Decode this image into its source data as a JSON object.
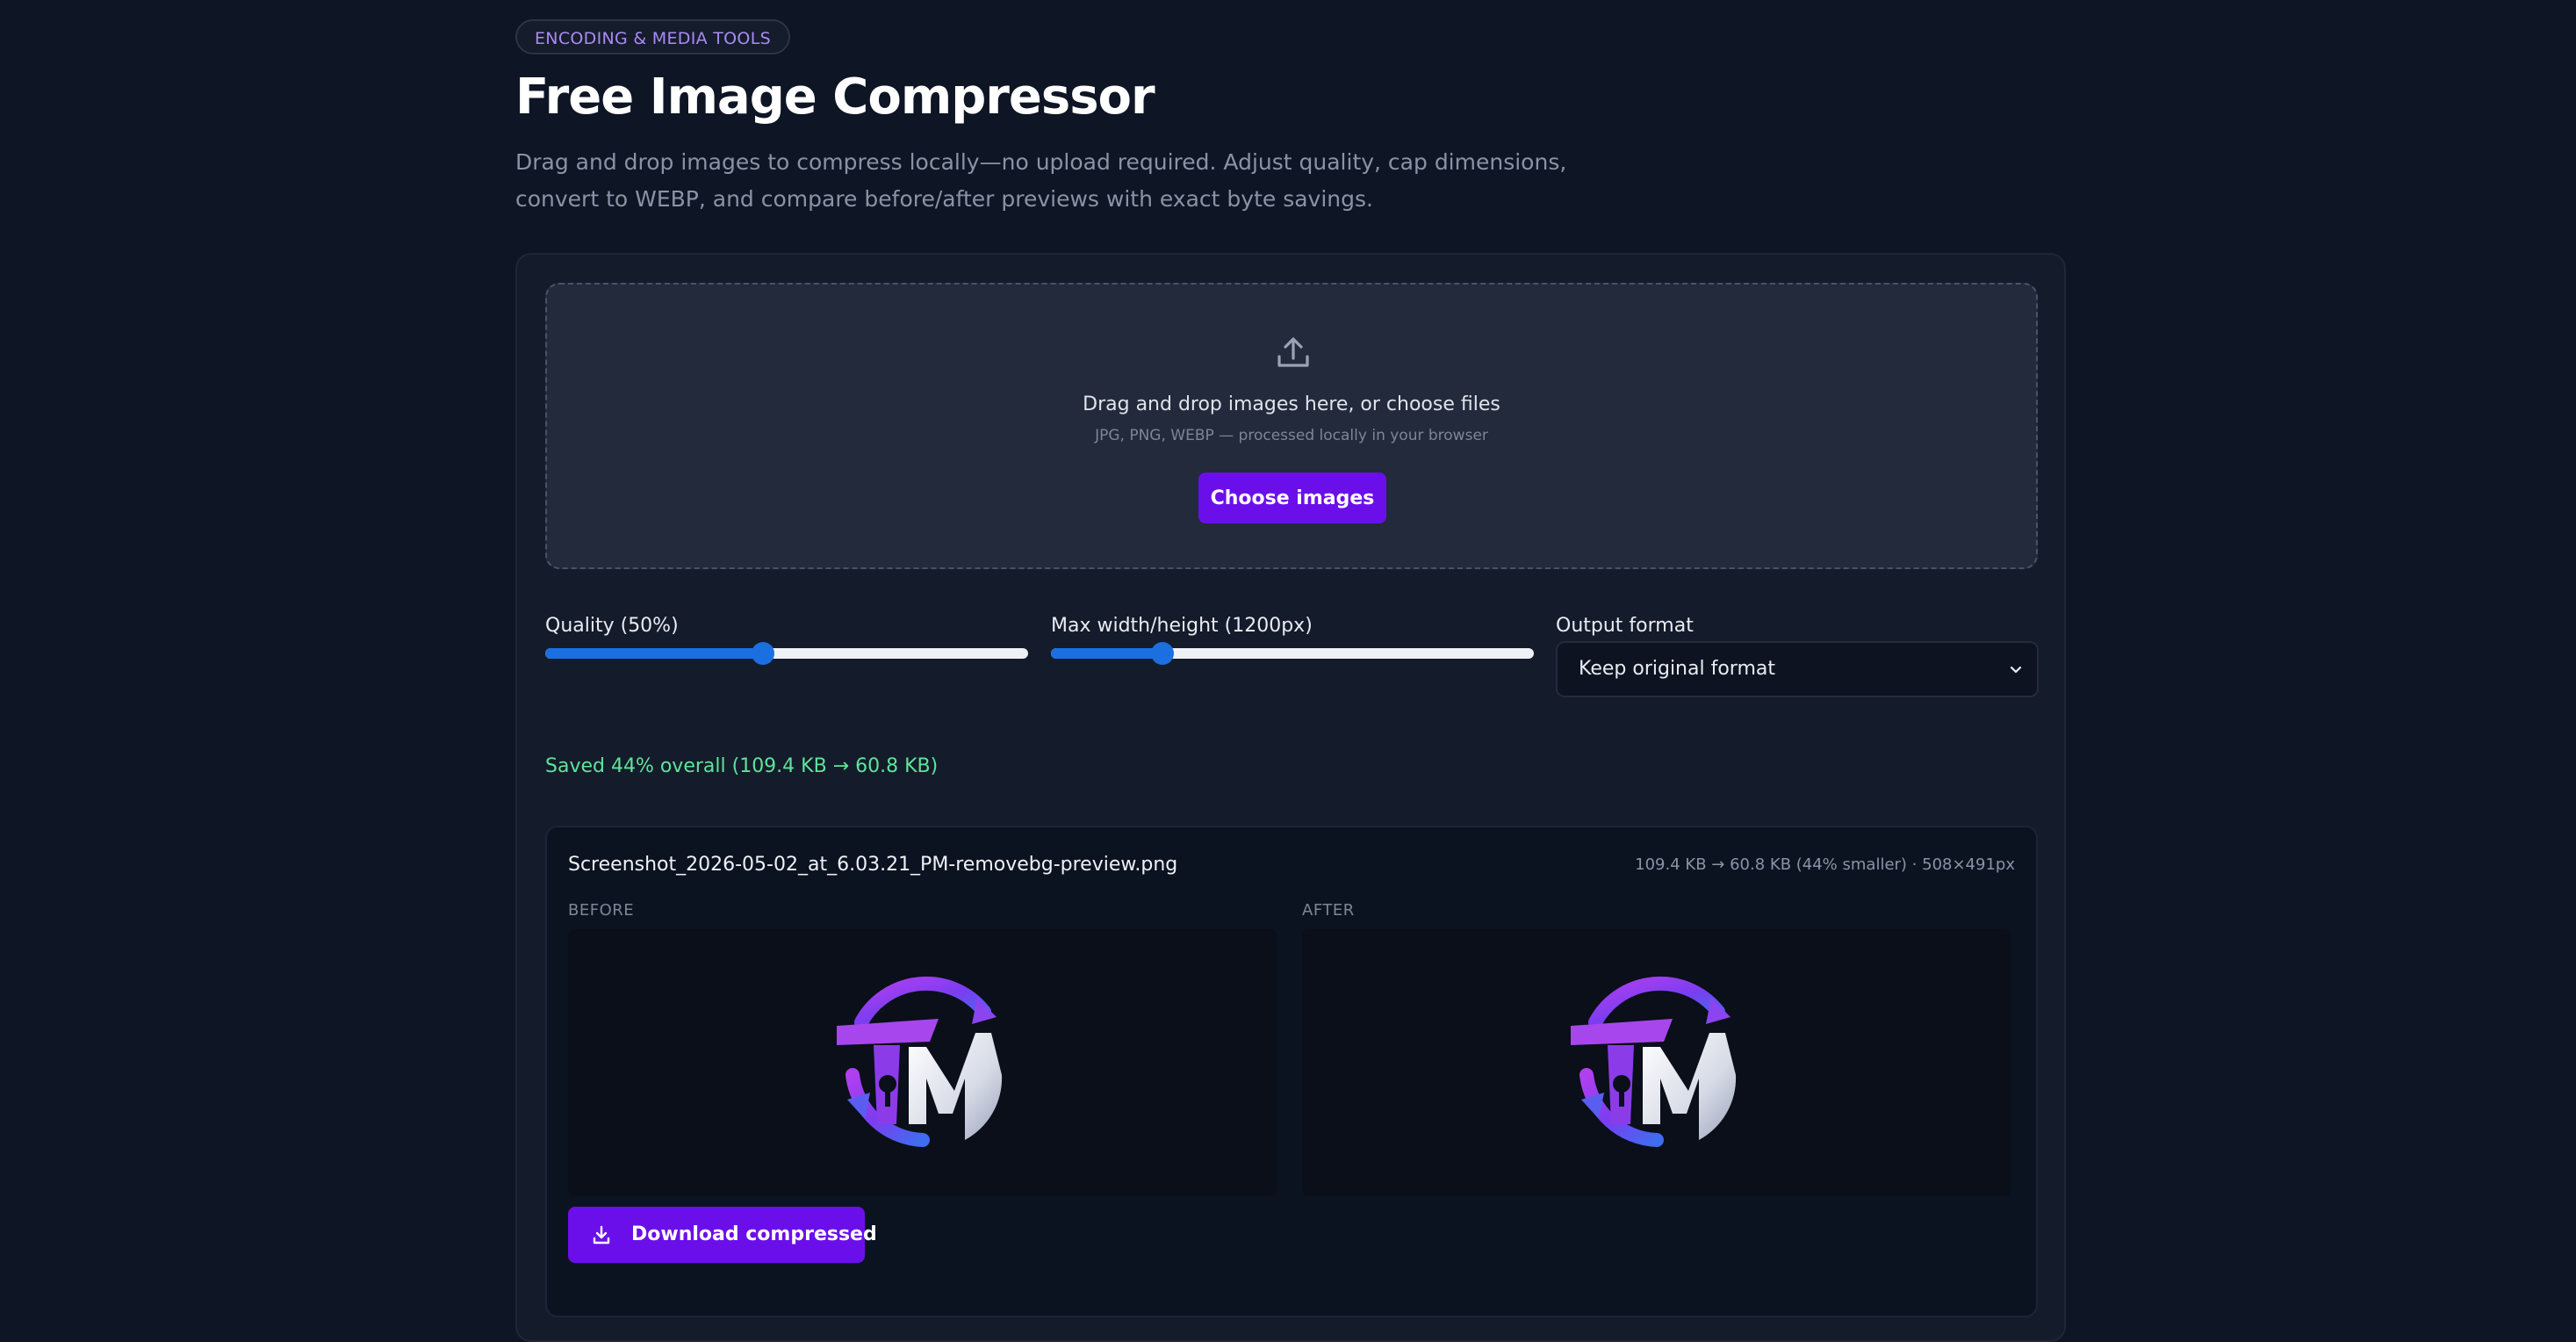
{
  "header": {
    "category": "ENCODING & MEDIA TOOLS",
    "title": "Free Image Compressor",
    "description": "Drag and drop images to compress locally—no upload required. Adjust quality, cap dimensions, convert to WEBP, and compare before/after previews with exact byte savings."
  },
  "dropzone": {
    "icon": "upload-icon",
    "title": "Drag and drop images here, or choose files",
    "hint": "JPG, PNG, WEBP — processed locally in your browser",
    "button_label": "Choose images"
  },
  "controls": {
    "quality": {
      "label": "Quality (50%)",
      "value_fraction": 0.45
    },
    "max_dimension": {
      "label": "Max width/height (1200px)",
      "value_fraction": 0.23
    },
    "output_format": {
      "label": "Output format",
      "selected": "Keep original format"
    }
  },
  "summary": {
    "savings_text": "Saved 44% overall (109.4 KB → 60.8 KB)"
  },
  "result": {
    "file_name": "Screenshot_2026-05-02_at_6.03.21_PM-removebg-preview.png",
    "stats": "109.4 KB → 60.8 KB (44% smaller) · 508×491px",
    "before_label": "BEFORE",
    "after_label": "AFTER",
    "download_label": "Download compressed"
  },
  "colors": {
    "background": "#0e1524",
    "accent": "#6b0fea",
    "slider": "#1b6fe0",
    "success": "#5ee49a"
  }
}
